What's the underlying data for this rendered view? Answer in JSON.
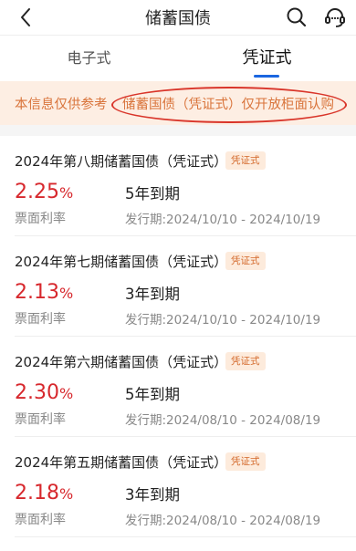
{
  "header": {
    "title": "储蓄国债",
    "back_icon": "chevron-left-icon",
    "search_icon": "search-icon",
    "service_icon": "headset-icon"
  },
  "tabs": [
    {
      "label": "电子式",
      "active": false
    },
    {
      "label": "凭证式",
      "active": true
    }
  ],
  "notice": {
    "text": "本信息仅供参考",
    "highlight": "储蓄国债（凭证式）仅开放柜面认购"
  },
  "bonds": [
    {
      "title": "2024年第八期储蓄国债（凭证式）",
      "badge": "凭证式",
      "rate": "2.25",
      "rate_unit": "%",
      "rate_label": "票面利率",
      "term": "5年到期",
      "period": "发行期:2024/10/10 - 2024/10/19"
    },
    {
      "title": "2024年第七期储蓄国债（凭证式）",
      "badge": "凭证式",
      "rate": "2.13",
      "rate_unit": "%",
      "rate_label": "票面利率",
      "term": "3年到期",
      "period": "发行期:2024/10/10 - 2024/10/19"
    },
    {
      "title": "2024年第六期储蓄国债（凭证式）",
      "badge": "凭证式",
      "rate": "2.30",
      "rate_unit": "%",
      "rate_label": "票面利率",
      "term": "5年到期",
      "period": "发行期:2024/08/10 - 2024/08/19"
    },
    {
      "title": "2024年第五期储蓄国债（凭证式）",
      "badge": "凭证式",
      "rate": "2.18",
      "rate_unit": "%",
      "rate_label": "票面利率",
      "term": "3年到期",
      "period": "发行期:2024/08/10 - 2024/08/19"
    }
  ],
  "colors": {
    "accent_red": "#d7282d",
    "notice_orange": "#d9743b",
    "tab_indicator": "#1a66e0"
  }
}
